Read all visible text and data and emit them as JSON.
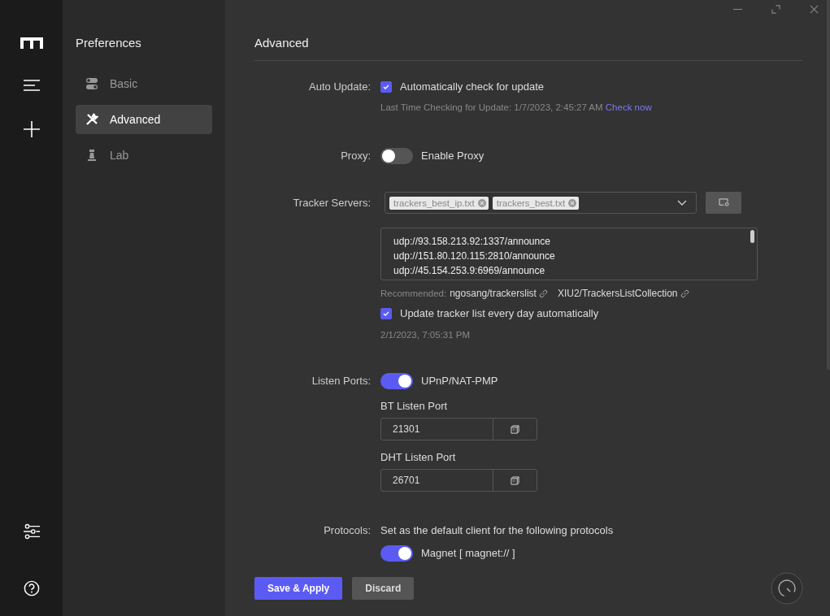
{
  "sidebar": {
    "title": "Preferences",
    "items": [
      {
        "label": "Basic",
        "kind": "toggles",
        "selected": false
      },
      {
        "label": "Advanced",
        "kind": "tools",
        "selected": true
      },
      {
        "label": "Lab",
        "kind": "flask",
        "selected": false
      }
    ]
  },
  "page": {
    "title": "Advanced"
  },
  "auto_update": {
    "label": "Auto Update:",
    "option": {
      "label": "Automatically check for update",
      "checked": true
    },
    "last_check": "Last Time Checking for Update: 1/7/2023, 2:45:27 AM",
    "check_now": "Check now"
  },
  "proxy": {
    "label": "Proxy:",
    "toggle": {
      "label": "Enable Proxy",
      "on": false
    }
  },
  "tracker_servers": {
    "label": "Tracker Servers:",
    "tags": [
      "trackers_best_ip.txt",
      "trackers_best.txt"
    ],
    "trackers": [
      "udp://93.158.213.92:1337/announce",
      "udp://151.80.120.115:2810/announce",
      "udp://45.154.253.9:6969/announce"
    ],
    "recommended_label": "Recommended:",
    "recommended_links": [
      "ngosang/trackerslist",
      "XIU2/TrackersListCollection"
    ],
    "daily_update": {
      "label": "Update tracker list every day automatically",
      "checked": true
    },
    "last_update": "2/1/2023, 7:05:31 PM"
  },
  "listen_ports": {
    "label": "Listen Ports:",
    "upnp": {
      "label": "UPnP/NAT-PMP",
      "on": true
    },
    "ports": [
      {
        "label": "BT Listen Port",
        "value": "21301"
      },
      {
        "label": "DHT Listen Port",
        "value": "26701"
      }
    ]
  },
  "protocols": {
    "label": "Protocols:",
    "description": "Set as the default client for the following protocols",
    "items": [
      {
        "label": "Magnet [ magnet:// ]",
        "on": true
      }
    ]
  },
  "buttons": [
    {
      "label": "Save & Apply",
      "kind": "primary"
    },
    {
      "label": "Discard",
      "kind": "secondary"
    }
  ]
}
